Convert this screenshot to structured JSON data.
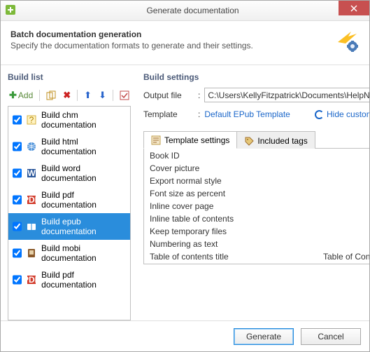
{
  "window": {
    "title": "Generate documentation"
  },
  "header": {
    "title": "Batch documentation generation",
    "subtitle": "Specify the documentation formats to generate and their settings."
  },
  "buildList": {
    "section_title": "Build list",
    "add_label": "Add",
    "items": [
      {
        "label": "Build chm documentation",
        "checked": true,
        "selected": false,
        "icon": "chm"
      },
      {
        "label": "Build html documentation",
        "checked": true,
        "selected": false,
        "icon": "html"
      },
      {
        "label": "Build word documentation",
        "checked": true,
        "selected": false,
        "icon": "word"
      },
      {
        "label": "Build pdf documentation",
        "checked": true,
        "selected": false,
        "icon": "pdf"
      },
      {
        "label": "Build epub documentation",
        "checked": true,
        "selected": true,
        "icon": "epub"
      },
      {
        "label": "Build mobi documentation",
        "checked": true,
        "selected": false,
        "icon": "mobi"
      },
      {
        "label": "Build pdf documentation",
        "checked": true,
        "selected": false,
        "icon": "pdf"
      }
    ]
  },
  "settings": {
    "section_title": "Build settings",
    "output_label": "Output file",
    "output_value": "C:\\Users\\KellyFitzpatrick\\Documents\\HelpND",
    "template_label": "Template",
    "template_value": "Default EPub Template",
    "hide_customization": "Hide customization",
    "tabs": {
      "template": "Template settings",
      "included": "Included tags"
    },
    "rows": [
      {
        "label": "Book ID",
        "type": "text",
        "value": ""
      },
      {
        "label": "Cover picture",
        "type": "text",
        "value": ""
      },
      {
        "label": "Export normal style",
        "type": "check",
        "checked": false
      },
      {
        "label": "Font size as percent",
        "type": "check",
        "checked": true
      },
      {
        "label": "Inline cover page",
        "type": "check",
        "checked": false
      },
      {
        "label": "Inline table of contents",
        "type": "check",
        "checked": false
      },
      {
        "label": "Keep temporary files",
        "type": "check",
        "checked": false
      },
      {
        "label": "Numbering as text",
        "type": "check",
        "checked": false
      },
      {
        "label": "Table of contents title",
        "type": "text",
        "value": "Table of Contents"
      }
    ]
  },
  "footer": {
    "generate": "Generate",
    "cancel": "Cancel"
  },
  "colors": {
    "accent": "#2a8ddc"
  }
}
